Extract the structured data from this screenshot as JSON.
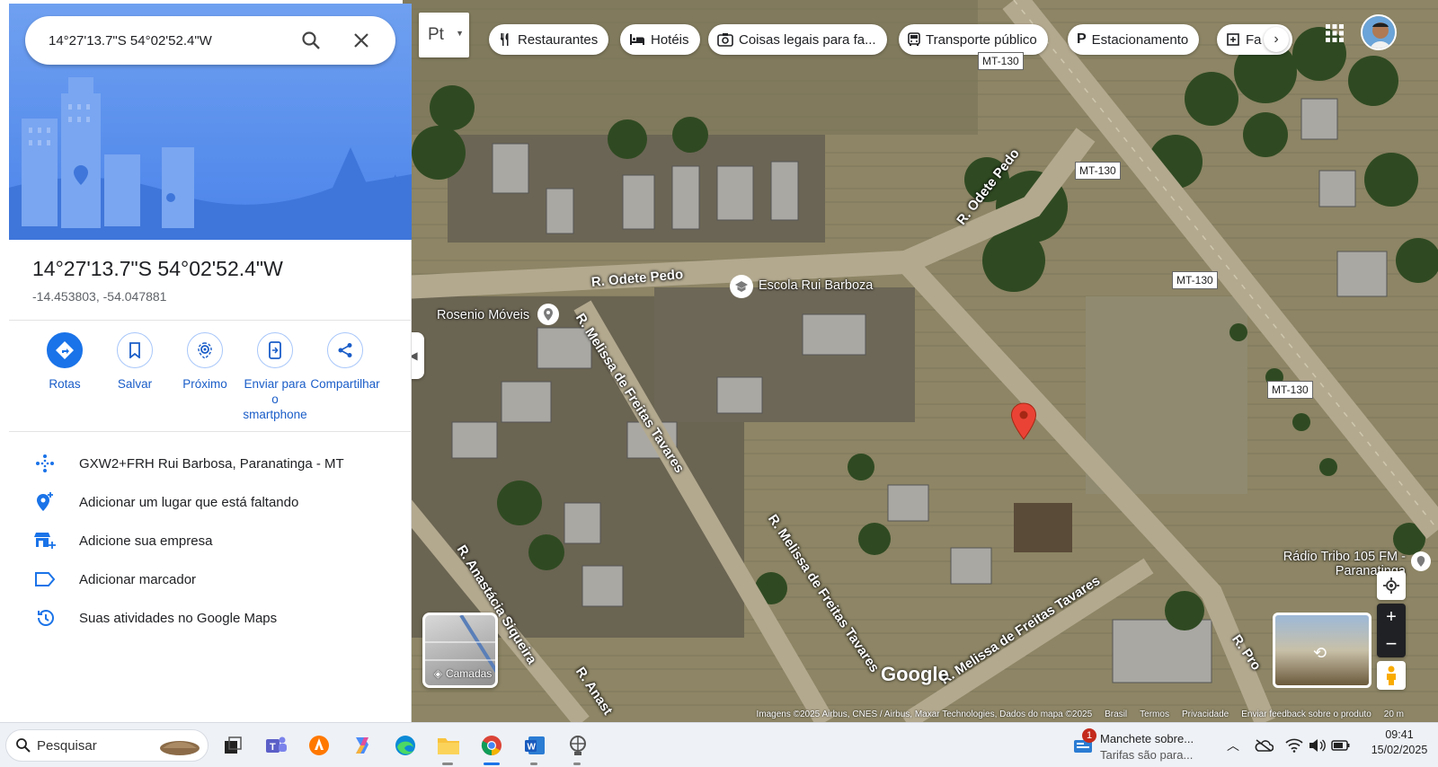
{
  "search": {
    "value": "14°27'13.7\"S 54°02'52.4\"W"
  },
  "place": {
    "title": "14°27'13.7\"S 54°02'52.4\"W",
    "coords": "-14.453803, -54.047881"
  },
  "actions": [
    {
      "label": "Rotas",
      "icon": "directions-icon"
    },
    {
      "label": "Salvar",
      "icon": "bookmark-icon"
    },
    {
      "label": "Próximo",
      "icon": "nearby-icon"
    },
    {
      "label": "Enviar para o smartphone",
      "icon": "send-to-phone-icon"
    },
    {
      "label": "Compartilhar",
      "icon": "share-icon"
    }
  ],
  "rows": [
    {
      "text": "GXW2+FRH Rui Barbosa, Paranatinga - MT",
      "icon": "plus-code-icon"
    },
    {
      "text": "Adicionar um lugar que está faltando",
      "icon": "add-place-icon"
    },
    {
      "text": "Adicione sua empresa",
      "icon": "add-business-icon"
    },
    {
      "text": "Adicionar marcador",
      "icon": "label-icon"
    },
    {
      "text": "Suas atividades no Google Maps",
      "icon": "history-icon"
    }
  ],
  "map": {
    "lang_button": "Pt",
    "chips": [
      "Restaurantes",
      "Hotéis",
      "Coisas legais para fa...",
      "Transporte público",
      "Estacionamento",
      "Fa"
    ],
    "places": [
      "Rosenio Móveis",
      "Escola Rui Barboza",
      "Rádio Tribo 105 FM - Paranatinga"
    ],
    "roads": [
      "R. Odete Pedo",
      "R. Odete Pedo",
      "R. Melissa de Freitas Tavares",
      "R. Melissa de Freitas Tavares",
      "R. Melissa de Freitas Tavares",
      "R. Anastácia Siqueira",
      "R. Anast",
      "R. Pro"
    ],
    "shields": [
      "MT-130",
      "MT-130",
      "MT-130",
      "MT-130"
    ],
    "layers_label": "Camadas",
    "logo": "Google",
    "attribution": [
      "Imagens ©2025 Airbus, CNES / Airbus, Maxar Technologies, Dados do mapa ©2025",
      "Brasil",
      "Termos",
      "Privacidade",
      "Enviar feedback sobre o produto",
      "20 m"
    ]
  },
  "taskbar": {
    "search": "Pesquisar",
    "news_title": "Manchete sobre...",
    "news_sub": "Tarifas são para...",
    "news_badge": "1",
    "time": "09:41",
    "date": "15/02/2025"
  },
  "colors": {
    "accent": "#1a73e8",
    "pin": "#ea4335",
    "hero": "#5b8def"
  }
}
